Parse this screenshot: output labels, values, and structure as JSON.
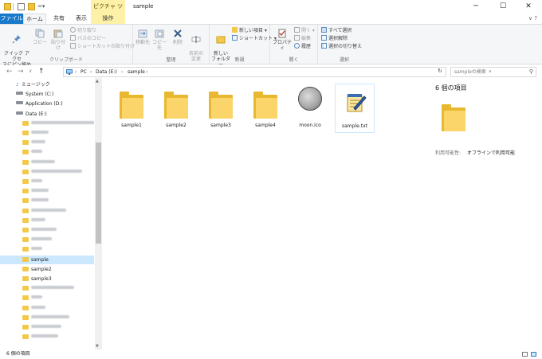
{
  "window": {
    "context_tab": "ピクチャ ツール",
    "title": "sample",
    "minimize": "─",
    "maximize": "☐",
    "close": "✕"
  },
  "ribbon_tabs": {
    "file": "ファイル",
    "home": "ホーム",
    "share": "共有",
    "view": "表示",
    "manage": "操作",
    "help": "∨ ?"
  },
  "ribbon": {
    "clipboard": {
      "label": "クリップボード",
      "pin": "クイック アクセ\nスにピン留め",
      "copy": "コピー",
      "paste": "貼り付け",
      "cut": "切り取り",
      "copy_path": "パスのコピー",
      "paste_shortcut": "ショートカットの貼り付け"
    },
    "organize": {
      "label": "整理",
      "move_to": "移動先",
      "copy_to": "コピー先",
      "delete": "削除",
      "rename": "名前の\n変更"
    },
    "new": {
      "label": "新規",
      "new_folder": "新しい\nフォルダー",
      "new_item": "新しい項目 ▾",
      "shortcut": "ショートカット ▾"
    },
    "open": {
      "label": "開く",
      "properties": "プロパティ",
      "open": "開く ▾",
      "edit": "編集",
      "history": "履歴"
    },
    "select": {
      "label": "選択",
      "select_all": "すべて選択",
      "select_none": "選択解除",
      "invert": "選択の切り替え"
    }
  },
  "address": {
    "back": "←",
    "forward": "→",
    "dropdown": "∨",
    "up": "↑",
    "crumbs": [
      "PC",
      "›",
      "Data (E:)",
      "›",
      "sample",
      "›"
    ],
    "expand": "∨",
    "refresh": "↻",
    "search_placeholder": "sampleの検索",
    "search_icon": "⚲"
  },
  "nav": {
    "items": [
      {
        "label": "ミュージック",
        "type": "music"
      },
      {
        "label": "System (C:)",
        "type": "drive"
      },
      {
        "label": "Application (D:)",
        "type": "drive"
      },
      {
        "label": "Data (E:)",
        "type": "drive"
      },
      {
        "label": "",
        "type": "blur",
        "w": 84
      },
      {
        "label": "",
        "type": "blur",
        "w": 22
      },
      {
        "label": "",
        "type": "blur",
        "w": 18
      },
      {
        "label": "",
        "type": "blur",
        "w": 14
      },
      {
        "label": "",
        "type": "blur",
        "w": 30
      },
      {
        "label": "",
        "type": "blur",
        "w": 64
      },
      {
        "label": "",
        "type": "blur",
        "w": 14
      },
      {
        "label": "",
        "type": "blur",
        "w": 22
      },
      {
        "label": "",
        "type": "blur",
        "w": 22
      },
      {
        "label": "",
        "type": "blur",
        "w": 44
      },
      {
        "label": "",
        "type": "blur",
        "w": 18
      },
      {
        "label": "",
        "type": "blur",
        "w": 32
      },
      {
        "label": "",
        "type": "blur",
        "w": 26
      },
      {
        "label": "",
        "type": "blur",
        "w": 14
      },
      {
        "label": "sample",
        "type": "folder",
        "selected": true
      },
      {
        "label": "sample2",
        "type": "folder"
      },
      {
        "label": "sample3",
        "type": "folder"
      },
      {
        "label": "",
        "type": "blur",
        "w": 54
      },
      {
        "label": "",
        "type": "blur",
        "w": 14
      },
      {
        "label": "",
        "type": "blur",
        "w": 18
      },
      {
        "label": "",
        "type": "blur",
        "w": 48
      },
      {
        "label": "",
        "type": "blur",
        "w": 38
      },
      {
        "label": "",
        "type": "blur",
        "w": 34
      }
    ]
  },
  "files": [
    {
      "name": "sample1",
      "kind": "folder"
    },
    {
      "name": "sample2",
      "kind": "folder"
    },
    {
      "name": "sample3",
      "kind": "folder"
    },
    {
      "name": "sample4",
      "kind": "folder"
    },
    {
      "name": "moon.ico",
      "kind": "moon"
    },
    {
      "name": "sample.txt",
      "kind": "notepad"
    }
  ],
  "details": {
    "title": "6 個の項目",
    "availability_label": "利用可能性:",
    "availability_value": "オフラインで利用可能"
  },
  "status": {
    "count": "6 個の項目"
  },
  "colors": {
    "accent": "#1979ca",
    "folder": "#f2c94c",
    "selection": "#cce8ff",
    "context_tab": "#fdf1a8"
  }
}
